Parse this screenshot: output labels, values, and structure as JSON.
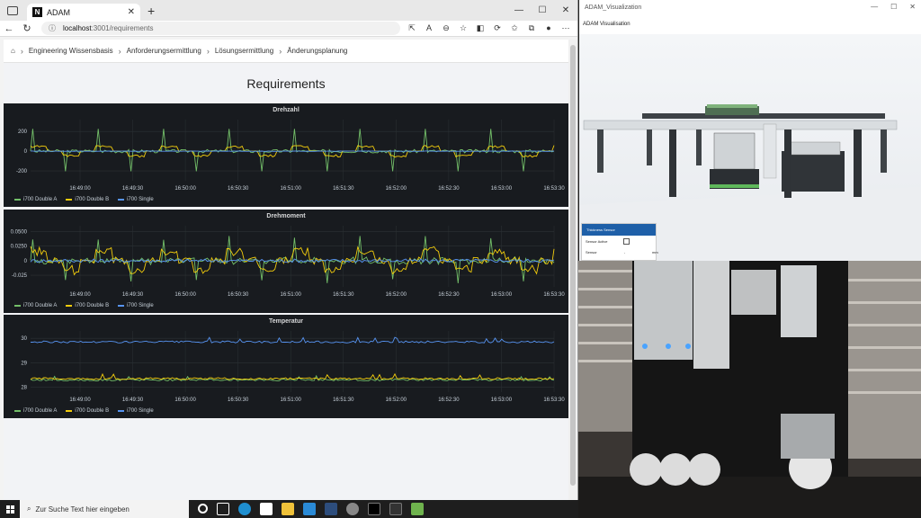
{
  "browser": {
    "tab_title": "ADAM",
    "tab_logo": "N",
    "url_host": "localhost",
    "url_path": ":3001/requirements",
    "icons": [
      "back-icon",
      "refresh-icon",
      "info-icon",
      "share-icon",
      "read-aloud-icon",
      "zoom-icon",
      "favorite-add-icon",
      "extensions-icon",
      "favorites-icon",
      "collections-icon",
      "profile-icon",
      "more-icon"
    ]
  },
  "breadcrumb": [
    "Engineering Wissensbasis",
    "Anforderungsermittlung",
    "Lösungsermittlung",
    "Änderungsplanung"
  ],
  "page_title": "Requirements",
  "chart_data": [
    {
      "type": "line",
      "title": "Drehzahl",
      "x_ticks": [
        "16:49:00",
        "16:49:30",
        "16:50:00",
        "16:50:30",
        "16:51:00",
        "16:51:30",
        "16:52:00",
        "16:52:30",
        "16:53:00",
        "16:53:30"
      ],
      "y_ticks": [
        "200",
        "0",
        "-200"
      ],
      "ylim": [
        -300,
        320
      ],
      "series": [
        {
          "name": "i700 Double A",
          "color": "#73bf69",
          "pattern": "spikes"
        },
        {
          "name": "i700 Double B",
          "color": "#f2cc0c",
          "pattern": "steps"
        },
        {
          "name": "i700 Single",
          "color": "#5794f2",
          "pattern": "flat"
        }
      ]
    },
    {
      "type": "line",
      "title": "Drehmoment",
      "x_ticks": [
        "16:49:00",
        "16:49:30",
        "16:50:00",
        "16:50:30",
        "16:51:00",
        "16:51:30",
        "16:52:00",
        "16:52:30",
        "16:53:00",
        "16:53:30"
      ],
      "y_ticks": [
        "0.0500",
        "0.0250",
        "0",
        "-0.025"
      ],
      "ylim": [
        -0.045,
        0.06
      ],
      "series": [
        {
          "name": "i700 Double A",
          "color": "#73bf69",
          "pattern": "spikes"
        },
        {
          "name": "i700 Double B",
          "color": "#f2cc0c",
          "pattern": "steps"
        },
        {
          "name": "i700 Single",
          "color": "#5794f2",
          "pattern": "noise"
        }
      ]
    },
    {
      "type": "line",
      "title": "Temperatur",
      "x_ticks": [
        "16:49:00",
        "16:49:30",
        "16:50:00",
        "16:50:30",
        "16:51:00",
        "16:51:30",
        "16:52:00",
        "16:52:30",
        "16:53:00",
        "16:53:30"
      ],
      "y_ticks": [
        "30",
        "29",
        "28"
      ],
      "ylim": [
        27.8,
        30.3
      ],
      "series": [
        {
          "name": "i700 Double A",
          "color": "#73bf69",
          "pattern": "level",
          "level": 28.3
        },
        {
          "name": "i700 Double B",
          "color": "#f2cc0c",
          "pattern": "level",
          "level": 28.35
        },
        {
          "name": "i700 Single",
          "color": "#5794f2",
          "pattern": "level",
          "level": 29.85
        }
      ]
    }
  ],
  "legend": [
    "i700 Double A",
    "i700 Double B",
    "i700 Single"
  ],
  "visualization": {
    "title": "ADAM_Visualization",
    "menu": "ADAM Visualisation",
    "sensor_header": "Thickness Sensor",
    "sensor_active_label": "Sensor Active",
    "sensor_label": "Sensor",
    "sensor_value": "-",
    "sensor_unit": "mm"
  },
  "taskbar": {
    "search_placeholder": "Zur Suche Text hier eingeben",
    "icons": [
      "task-view-icon",
      "edge-icon",
      "adam-icon",
      "file-explorer-icon",
      "vscode-icon",
      "terminal-icon",
      "chrome-icon",
      "cmd-icon",
      "app-icon",
      "notepad-icon"
    ]
  }
}
